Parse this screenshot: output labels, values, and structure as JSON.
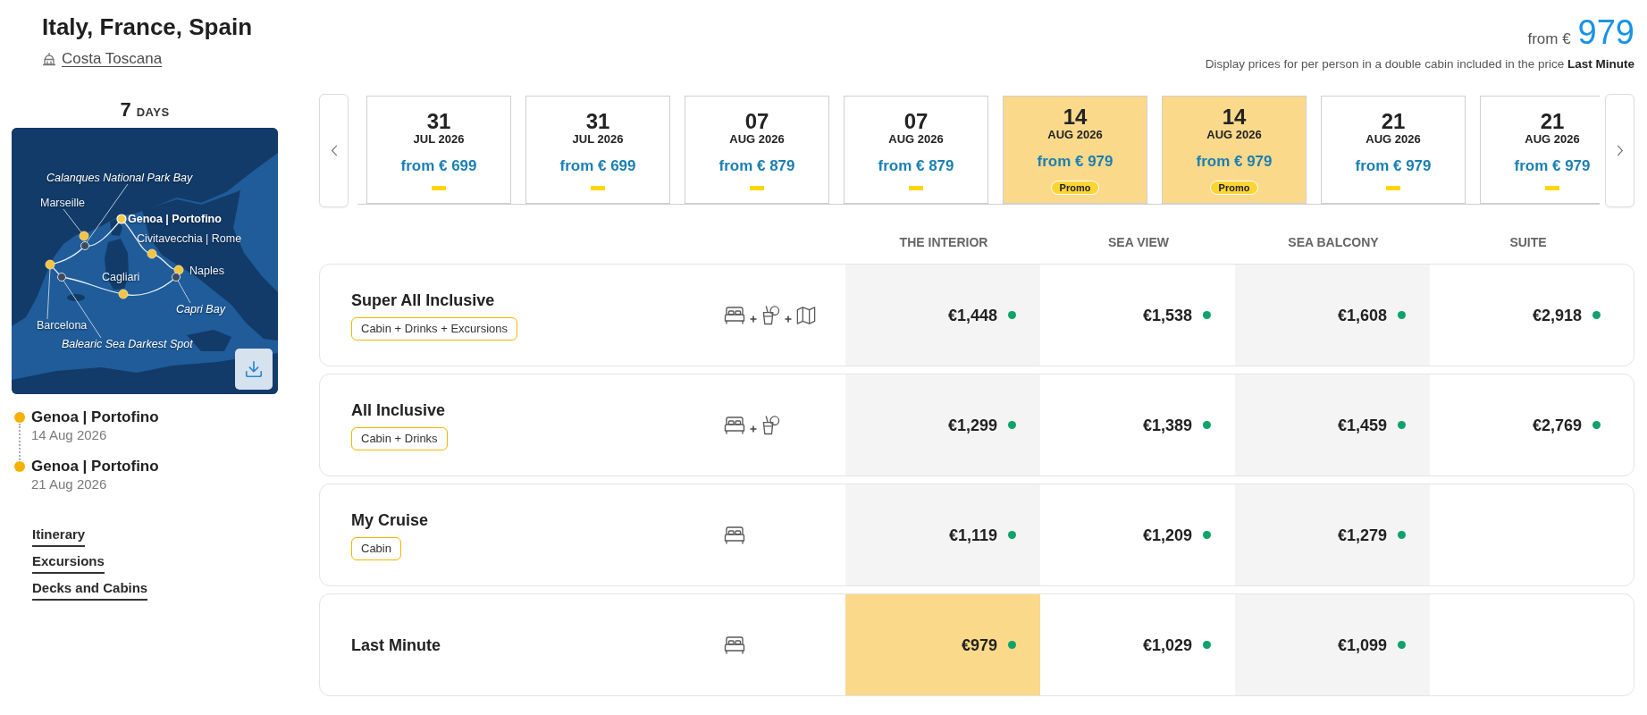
{
  "header": {
    "title": "Italy, France, Spain",
    "ship": "Costa Toscana"
  },
  "price_summary": {
    "prefix": "from €",
    "price": "979",
    "note": "Display prices for per person in a double cabin included in the price **Last Minute**"
  },
  "itinerary": {
    "duration": "7",
    "duration_unit": "DAYS",
    "map": {
      "labels": [
        {
          "text": "Calanques National Park Bay",
          "kind": "scenic"
        },
        {
          "text": "Marseille",
          "kind": "port"
        },
        {
          "text": "Genoa | Portofino",
          "kind": "home_port"
        },
        {
          "text": "Civitavecchia | Rome",
          "kind": "port"
        },
        {
          "text": "Naples",
          "kind": "port"
        },
        {
          "text": "Cagliari",
          "kind": "port"
        },
        {
          "text": "Capri Bay",
          "kind": "scenic"
        },
        {
          "text": "Barcelona",
          "kind": "port"
        },
        {
          "text": "Balearic Sea Darkest Spot",
          "kind": "scenic"
        }
      ]
    },
    "stops": [
      {
        "port": "Genoa | Portofino",
        "date": "14 Aug 2026"
      },
      {
        "port": "Genoa | Portofino",
        "date": "21 Aug 2026"
      }
    ],
    "links": [
      "Itinerary",
      "Excursions",
      "Decks and Cabins"
    ]
  },
  "dates": [
    {
      "day": "31",
      "month_year": "JUL 2026",
      "price": "from € 699",
      "selected": false,
      "marker": {
        "kind": "dash"
      }
    },
    {
      "day": "31",
      "month_year": "JUL 2026",
      "price": "from € 699",
      "selected": false,
      "marker": {
        "kind": "dash"
      }
    },
    {
      "day": "07",
      "month_year": "AUG 2026",
      "price": "from € 879",
      "selected": false,
      "marker": {
        "kind": "dash"
      }
    },
    {
      "day": "07",
      "month_year": "AUG 2026",
      "price": "from € 879",
      "selected": false,
      "marker": {
        "kind": "dash"
      }
    },
    {
      "day": "14",
      "month_year": "AUG 2026",
      "price": "from € 979",
      "selected": true,
      "marker": {
        "kind": "promo",
        "label": "Promo"
      }
    },
    {
      "day": "14",
      "month_year": "AUG 2026",
      "price": "from € 979",
      "selected": true,
      "marker": {
        "kind": "promo",
        "label": "Promo"
      }
    },
    {
      "day": "21",
      "month_year": "AUG 2026",
      "price": "from € 979",
      "selected": false,
      "marker": {
        "kind": "dash"
      }
    },
    {
      "day": "21",
      "month_year": "AUG 2026",
      "price": "from € 979",
      "selected": false,
      "marker": {
        "kind": "dash"
      }
    }
  ],
  "fares": {
    "columns": [
      "THE INTERIOR",
      "SEA VIEW",
      "SEA BALCONY",
      "SUITE"
    ],
    "rows": [
      {
        "name": "Super All Inclusive",
        "tag": "Cabin + Drinks + Excursions",
        "includes": [
          {
            "kind": "cabin"
          },
          {
            "kind": "drinks"
          },
          {
            "kind": "excursions"
          }
        ],
        "prices": [
          {
            "price": "€1,448",
            "available": true,
            "selected": false
          },
          {
            "price": "€1,538",
            "available": true,
            "selected": false
          },
          {
            "price": "€1,608",
            "available": true,
            "selected": false
          },
          {
            "price": "€2,918",
            "available": true,
            "selected": false
          }
        ]
      },
      {
        "name": "All Inclusive",
        "tag": "Cabin + Drinks",
        "includes": [
          {
            "kind": "cabin"
          },
          {
            "kind": "drinks"
          }
        ],
        "prices": [
          {
            "price": "€1,299",
            "available": true,
            "selected": false
          },
          {
            "price": "€1,389",
            "available": true,
            "selected": false
          },
          {
            "price": "€1,459",
            "available": true,
            "selected": false
          },
          {
            "price": "€2,769",
            "available": true,
            "selected": false
          }
        ]
      },
      {
        "name": "My Cruise",
        "tag": "Cabin",
        "includes": [
          {
            "kind": "cabin"
          }
        ],
        "prices": [
          {
            "price": "€1,119",
            "available": true,
            "selected": false
          },
          {
            "price": "€1,209",
            "available": true,
            "selected": false
          },
          {
            "price": "€1,279",
            "available": true,
            "selected": false
          }
        ]
      },
      {
        "name": "Last Minute",
        "includes": [
          {
            "kind": "cabin"
          }
        ],
        "prices": [
          {
            "price": "€979",
            "available": true,
            "selected": true
          },
          {
            "price": "€1,029",
            "available": true,
            "selected": false
          },
          {
            "price": "€1,099",
            "available": true,
            "selected": false
          }
        ]
      }
    ]
  }
}
